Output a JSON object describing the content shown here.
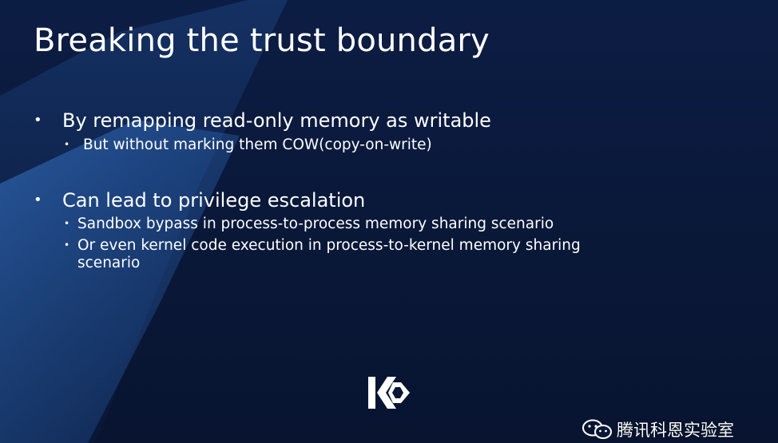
{
  "slide": {
    "title": "Breaking the trust boundary",
    "bullets": [
      {
        "marker": "•",
        "text": "By remapping read-only memory as writable",
        "sub": [
          {
            "marker": "•",
            "text": "But without marking them COW(copy-on-write)"
          }
        ]
      },
      {
        "marker": "•",
        "text": "Can lead to privilege escalation",
        "sub": [
          {
            "marker": "•",
            "text": "Sandbox bypass in process-to-process memory sharing scenario"
          },
          {
            "marker": "•",
            "text_line1": "Or even kernel code execution in process-to-kernel memory sharing",
            "text_line2": "scenario"
          }
        ]
      }
    ]
  },
  "logo": {
    "icon": "keen-lab-logo-icon",
    "color": "#ffffff"
  },
  "watermark": {
    "icon": "wechat-icon",
    "text": "腾讯科恩实验室"
  },
  "colors": {
    "background": "#0b1a3e",
    "text": "#ffffff",
    "accent": "#2c6fc4"
  }
}
